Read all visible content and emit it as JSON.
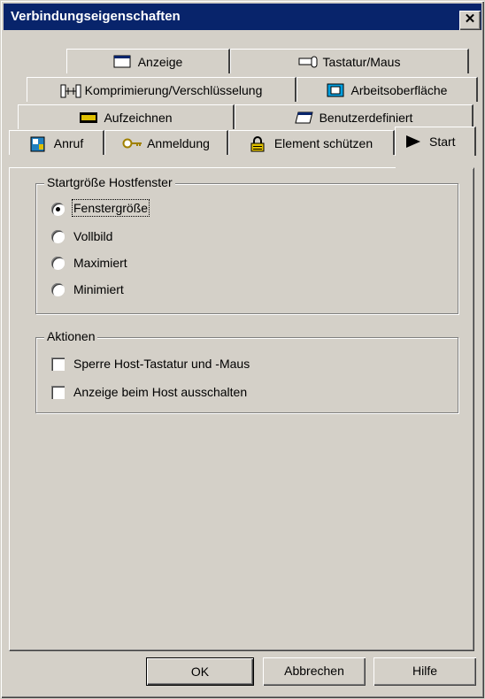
{
  "window": {
    "title": "Verbindungseigenschaften",
    "close_glyph": "✕"
  },
  "tabs": {
    "row1": [
      {
        "label": "Anzeige",
        "icon": "monitor-icon"
      },
      {
        "label": "Tastatur/Maus",
        "icon": "keyboard-mouse-icon"
      }
    ],
    "row2": [
      {
        "label": "Komprimierung/Verschlüsselung",
        "icon": "compression-icon"
      },
      {
        "label": "Arbeitsoberfläche",
        "icon": "desktop-icon"
      }
    ],
    "row3": [
      {
        "label": "Aufzeichnen",
        "icon": "record-icon"
      },
      {
        "label": "Benutzerdefiniert",
        "icon": "custom-icon"
      }
    ],
    "row4": [
      {
        "label": "Anruf",
        "icon": "phonebook-icon"
      },
      {
        "label": "Anmeldung",
        "icon": "key-icon"
      },
      {
        "label": "Element schützen",
        "icon": "lock-icon"
      },
      {
        "label": "Start",
        "icon": "play-icon",
        "active": true
      }
    ]
  },
  "startsize_group": {
    "legend": "Startgröße Hostfenster",
    "options": [
      {
        "label": "Fenstergröße",
        "selected": true
      },
      {
        "label": "Vollbild",
        "selected": false
      },
      {
        "label": "Maximiert",
        "selected": false
      },
      {
        "label": "Minimiert",
        "selected": false
      }
    ]
  },
  "actions_group": {
    "legend": "Aktionen",
    "options": [
      {
        "label": "Sperre Host-Tastatur und -Maus",
        "checked": false
      },
      {
        "label": "Anzeige beim Host ausschalten",
        "checked": false
      }
    ]
  },
  "buttons": {
    "ok": "OK",
    "cancel": "Abbrechen",
    "help": "Hilfe"
  },
  "colors": {
    "titlebar": "#08246b",
    "face": "#d4d0c8",
    "shadow": "#808080",
    "highlight": "#ffffff"
  }
}
